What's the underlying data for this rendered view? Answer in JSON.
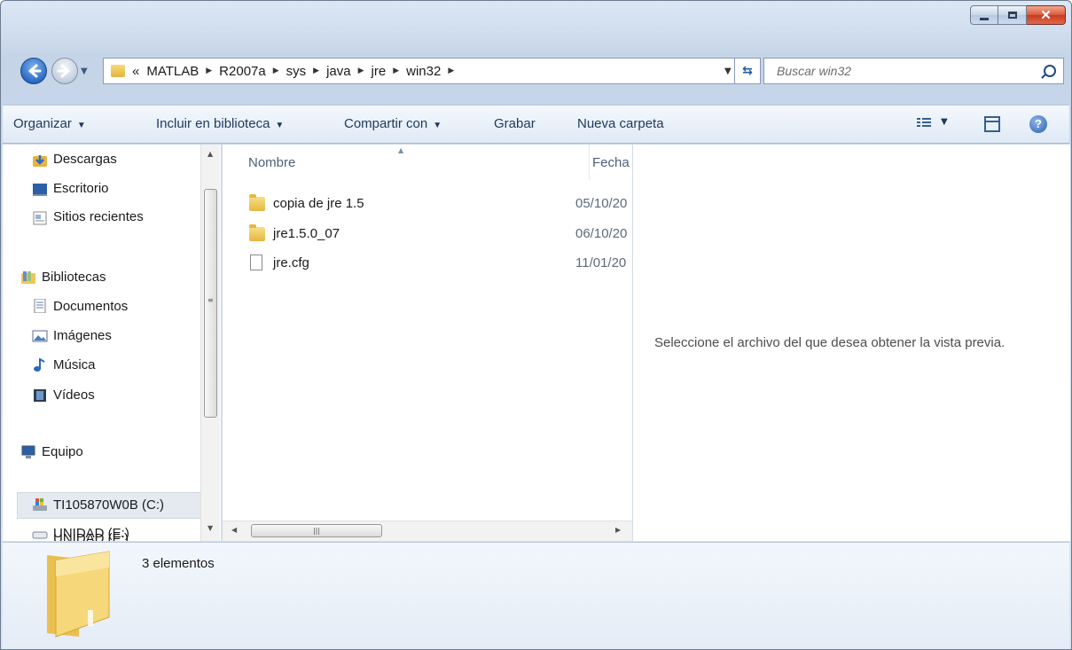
{
  "window": {
    "controls": {
      "minimize": "minimize-icon",
      "maximize": "maximize-icon",
      "close": "close-icon"
    }
  },
  "address": {
    "prefix": "«",
    "crumbs": [
      "MATLAB",
      "R2007a",
      "sys",
      "java",
      "jre",
      "win32"
    ],
    "search_placeholder": "Buscar win32"
  },
  "toolbar": {
    "organize": "Organizar",
    "include_library": "Incluir en biblioteca",
    "share_with": "Compartir con",
    "burn": "Grabar",
    "new_folder": "Nueva carpeta"
  },
  "nav": {
    "items": [
      {
        "label": "Descargas",
        "icon": "downloads-icon"
      },
      {
        "label": "Escritorio",
        "icon": "desktop-icon"
      },
      {
        "label": "Sitios recientes",
        "icon": "recent-places-icon"
      },
      {
        "label": "Bibliotecas",
        "icon": "libraries-icon"
      },
      {
        "label": "Documentos",
        "icon": "documents-icon"
      },
      {
        "label": "Imágenes",
        "icon": "pictures-icon"
      },
      {
        "label": "Música",
        "icon": "music-icon"
      },
      {
        "label": "Vídeos",
        "icon": "videos-icon"
      },
      {
        "label": "Equipo",
        "icon": "computer-icon"
      },
      {
        "label": "TI105870W0B (C:)",
        "icon": "drive-c-icon"
      },
      {
        "label": "UNIDAD (E:)",
        "icon": "drive-e-icon"
      },
      {
        "label": "UNIDAD (F:)",
        "icon": "drive-f-icon"
      }
    ],
    "selected": "TI105870W0B (C:)"
  },
  "files": {
    "columns": {
      "name": "Nombre",
      "date": "Fecha de"
    },
    "rows": [
      {
        "name": "copia de jre 1.5",
        "date": "05/10/20",
        "type": "folder"
      },
      {
        "name": "jre1.5.0_07",
        "date": "06/10/20",
        "type": "folder"
      },
      {
        "name": "jre.cfg",
        "date": "11/01/20",
        "type": "file"
      }
    ]
  },
  "preview": {
    "message": "Seleccione el archivo del que desea obtener la vista previa."
  },
  "details": {
    "count": "3 elementos"
  }
}
